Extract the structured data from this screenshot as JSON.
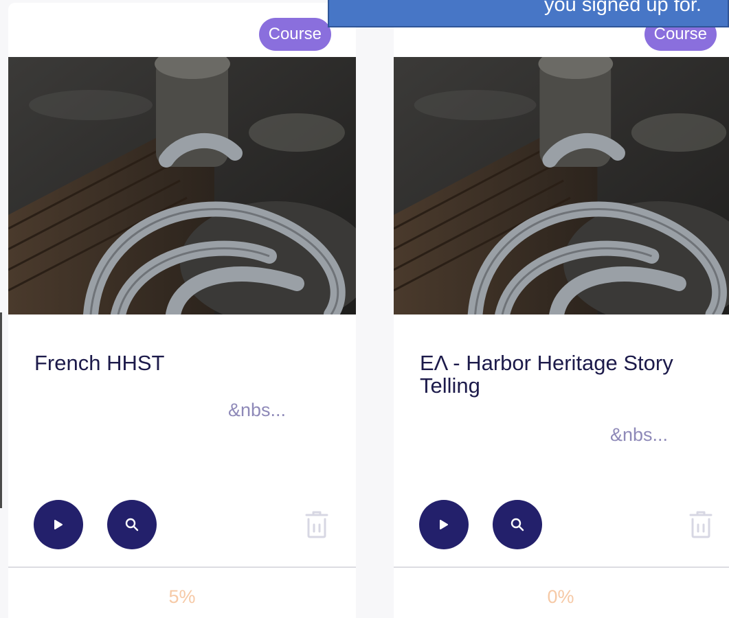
{
  "cards": [
    {
      "badge": "Course",
      "title": "French HHST",
      "snippet": "&nbs...",
      "progress": "5%"
    },
    {
      "badge": "Course",
      "title": "ΕΛ - Harbor Heritage Story Telling",
      "snippet": "&nbs...",
      "progress": "0%"
    }
  ],
  "tooltip": {
    "text": "you signed up for."
  },
  "colors": {
    "badge": "#8a6fdd",
    "primary_button": "#23206b",
    "title": "#1c1a4a",
    "snippet": "#8e89b8",
    "progress": "#f6c9a6",
    "tooltip_bg": "#4776c6"
  },
  "icons": {
    "play": "play-icon",
    "search": "search-icon",
    "delete": "trash-icon"
  }
}
